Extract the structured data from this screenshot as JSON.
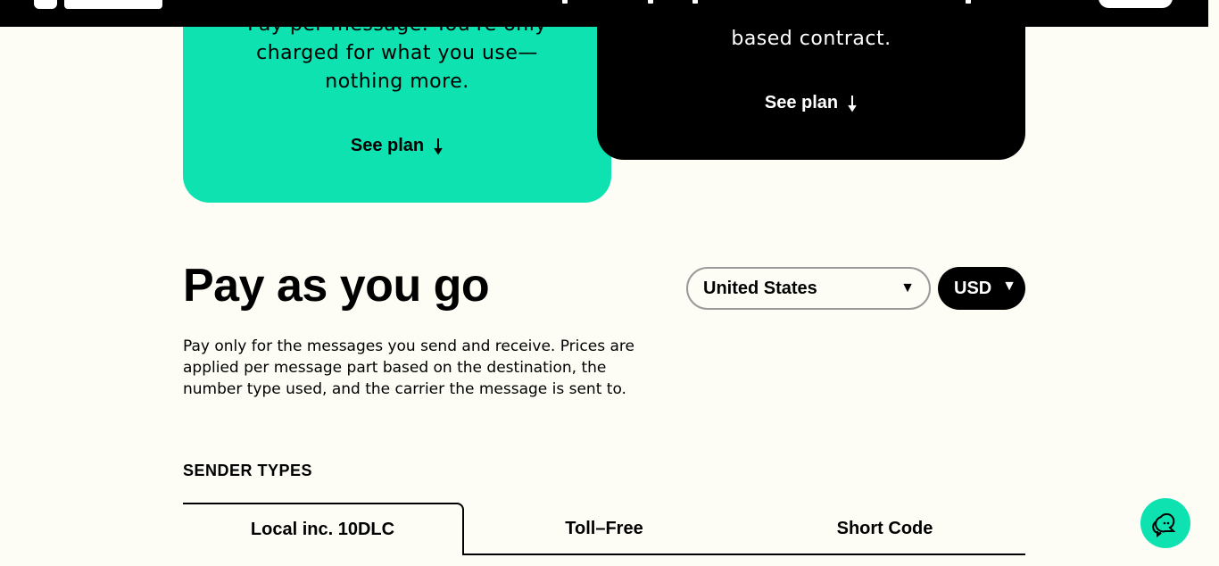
{
  "header": {
    "logo_icon": "telnyx-logo-icon",
    "cta_icon": "get-started-button"
  },
  "cards": {
    "pay_per_message": {
      "description": "Pay per message. You're only charged for what you use—nothing more.",
      "see_plan_label": "See plan",
      "arrow_icon": "arrow-down-icon",
      "background": "#0EE2B1"
    },
    "contract": {
      "description": "based contract.",
      "see_plan_label": "See plan",
      "arrow_icon": "arrow-down-icon",
      "background": "#000000"
    }
  },
  "pricing": {
    "title": "Pay as you go",
    "description": "Pay only for the messages you send and receive. Prices are applied per message part based on the destination, the number type used, and the carrier the message is sent to.",
    "country_select": {
      "value": "United States",
      "icon": "caret-down-icon"
    },
    "currency_select": {
      "value": "USD",
      "icon": "caret-down-icon"
    }
  },
  "sender_types": {
    "label": "SENDER TYPES",
    "tabs": [
      {
        "label": "Local inc. 10DLC",
        "active": true
      },
      {
        "label": "Toll–Free",
        "active": false
      },
      {
        "label": "Short Code",
        "active": false
      }
    ]
  },
  "chat": {
    "icon": "chat-support-icon",
    "background": "#0EE2B1"
  }
}
